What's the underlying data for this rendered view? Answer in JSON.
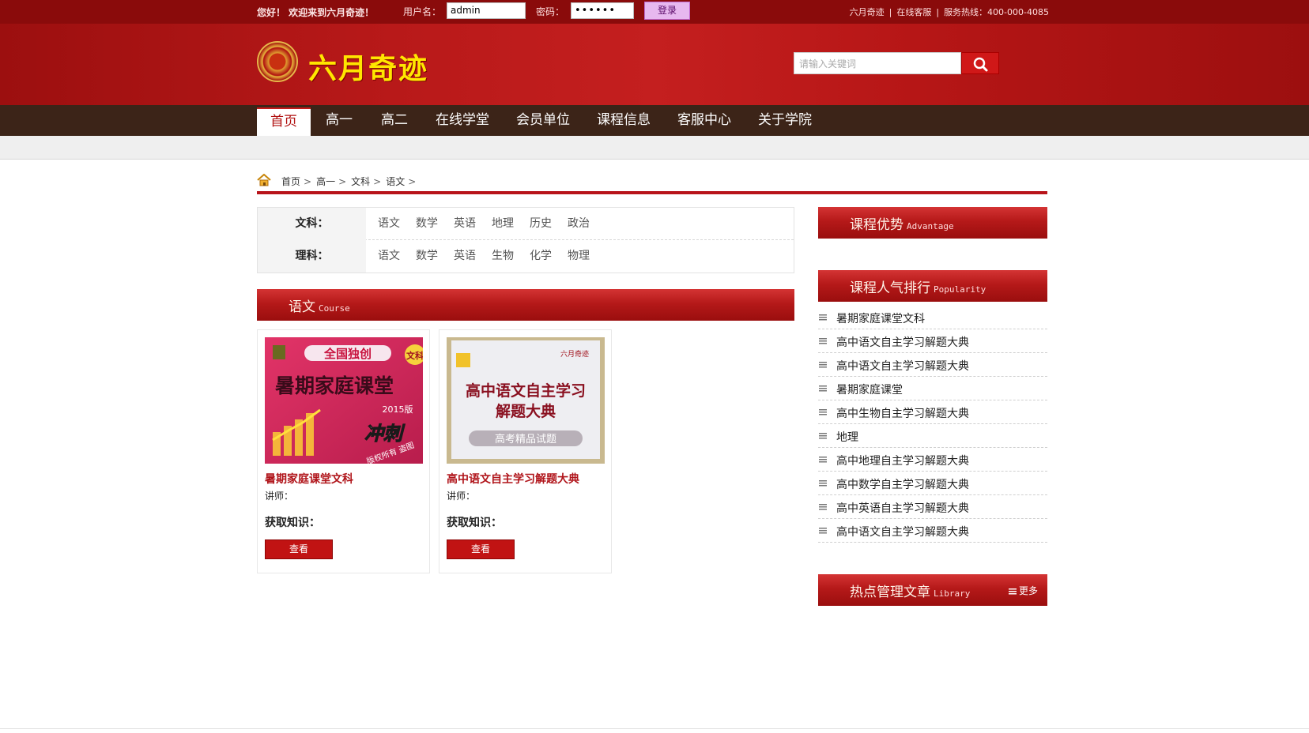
{
  "topbar": {
    "greeting": "您好！ 欢迎来到六月奇迹！",
    "username_label": "用户名：",
    "username_value": "admin",
    "password_label": "密码：",
    "password_value": "••••••",
    "login_label": "登录",
    "links": [
      "六月奇迹",
      "在线客服"
    ],
    "hotline": "服务热线：400-000-4085",
    "separator": "|"
  },
  "header": {
    "logo_text": "六月奇迹",
    "search_placeholder": "请输入关键词"
  },
  "nav": {
    "items": [
      "首页",
      "高一",
      "高二",
      "在线学堂",
      "会员单位",
      "课程信息",
      "客服中心",
      "关于学院"
    ],
    "active_index": 0
  },
  "breadcrumb": {
    "items": [
      "首页",
      "高一",
      "文科",
      "语文"
    ],
    "arrow": ">"
  },
  "filters": {
    "rows": [
      {
        "head": "文科：",
        "options": [
          "语文",
          "数学",
          "英语",
          "地理",
          "历史",
          "政治"
        ]
      },
      {
        "head": "理科：",
        "options": [
          "语文",
          "数学",
          "英语",
          "生物",
          "化学",
          "物理"
        ]
      }
    ]
  },
  "course_section": {
    "title": "语文",
    "title_en": "Course"
  },
  "cards": [
    {
      "title": "暑期家庭课堂文科",
      "teacher": "讲师：",
      "knowledge": "获取知识：",
      "button": "查看",
      "cover": {
        "top": "全国独创",
        "main": "暑期家庭课堂",
        "side": "文科",
        "year": "2015版",
        "slogan": "冲刺",
        "note": "版权所有 盗图"
      }
    },
    {
      "title": "高中语文自主学习解题大典",
      "teacher": "讲师：",
      "knowledge": "获取知识：",
      "button": "查看",
      "cover": {
        "brand": "六月奇迹",
        "main1": "高中语文自主学习",
        "main2": "解题大典",
        "band": "高考精品试题"
      }
    }
  ],
  "sidebar": {
    "advantage": {
      "title": "课程优势",
      "title_en": "Advantage"
    },
    "popularity": {
      "title": "课程人气排行",
      "title_en": "Popularity",
      "items": [
        "暑期家庭课堂文科",
        "高中语文自主学习解题大典",
        "高中语文自主学习解题大典",
        "暑期家庭课堂",
        "高中生物自主学习解题大典",
        "地理",
        "高中地理自主学习解题大典",
        "高中数学自主学习解题大典",
        "高中英语自主学习解题大典",
        "高中语文自主学习解题大典"
      ]
    },
    "library": {
      "title": "热点管理文章",
      "title_en": "Library",
      "more": "更多"
    }
  },
  "colors": {
    "brand_red": "#b8141a",
    "topbar": "#8a0b0b",
    "nav_bg": "#3c2418",
    "logo_yellow": "#ffe600"
  },
  "icons": [
    "home-icon",
    "search-icon",
    "list-icon",
    "seal-logo-icon"
  ]
}
